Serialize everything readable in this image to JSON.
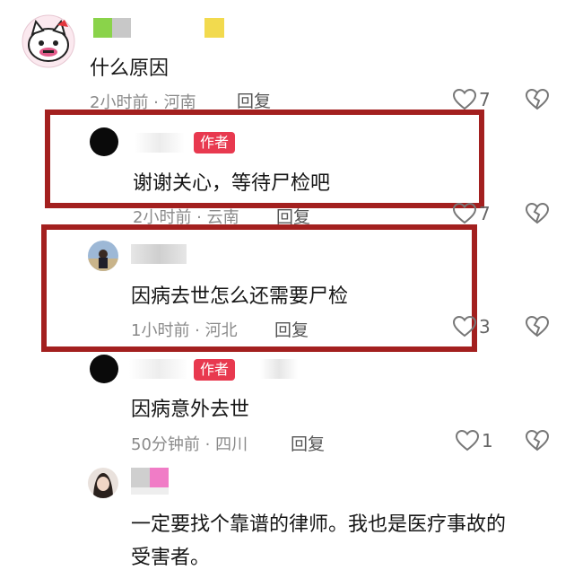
{
  "comments": [
    {
      "text": "什么原因",
      "time": "2小时前",
      "location": "河南",
      "reply_label": "回复",
      "likes": "7"
    },
    {
      "badge": "作者",
      "text": "谢谢关心，等待尸检吧",
      "time": "2小时前",
      "location": "云南",
      "reply_label": "回复",
      "likes": "7"
    },
    {
      "text": "因病去世怎么还需要尸检",
      "time": "1小时前",
      "location": "河北",
      "reply_label": "回复",
      "likes": "3"
    },
    {
      "badge": "作者",
      "text": "因病意外去世",
      "time": "50分钟前",
      "location": "四川",
      "reply_label": "回复",
      "likes": "1"
    },
    {
      "text": "一定要找个靠谱的律师。我也是医疗事故的",
      "text_line2": "受害者。"
    }
  ],
  "meta_separator": " · ",
  "colors": {
    "highlight_border": "#a3201f",
    "author_badge": "#e8394f"
  },
  "icons": {
    "like": "heart-outline-icon",
    "dislike": "broken-heart-icon"
  }
}
